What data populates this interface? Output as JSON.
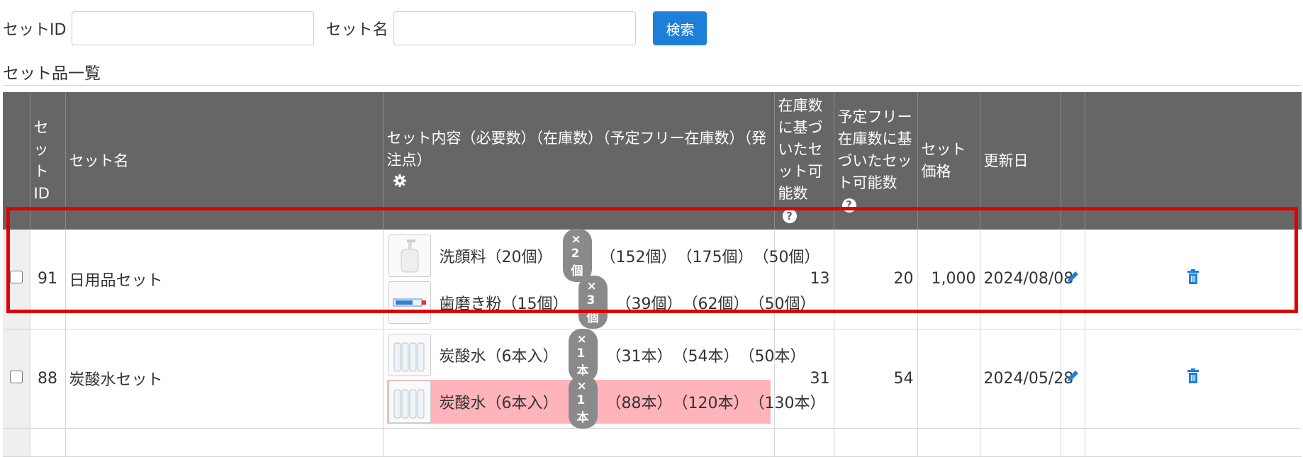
{
  "search": {
    "set_id_label": "セットID",
    "set_id_value": "",
    "set_name_label": "セット名",
    "set_name_value": "",
    "search_button": "検索"
  },
  "section_title": "セット品一覧",
  "table": {
    "headers": {
      "set_id": "セットID",
      "set_name": "セット名",
      "contents": "セット内容（必要数）（在庫数）（予定フリー在庫数）（発注点）",
      "available_by_stock": "在庫数に基づいたセット可能数",
      "available_by_free": "予定フリー在庫数に基づいたセット可能数",
      "price": "セット価格",
      "updated": "更新日"
    },
    "rows": [
      {
        "id": "91",
        "name": "日用品セット",
        "items": [
          {
            "name": "洗顔料（20個）",
            "badge": "× 2個",
            "stock": "（152個）",
            "free": "（175個）",
            "reorder": "（50個）",
            "warn": false,
            "thumb": "soap-bottle"
          },
          {
            "name": "歯磨き粉（15個）",
            "badge": "× 3個",
            "stock": "（39個）",
            "free": "（62個）",
            "reorder": "（50個）",
            "warn": false,
            "thumb": "toothpaste"
          }
        ],
        "by_stock": "13",
        "by_free": "20",
        "price": "1,000",
        "updated": "2024/08/08"
      },
      {
        "id": "88",
        "name": "炭酸水セット",
        "items": [
          {
            "name": "炭酸水（6本入）",
            "badge": "× 1本",
            "stock": "（31本）",
            "free": "（54本）",
            "reorder": "（50本）",
            "warn": false,
            "thumb": "water-bottles"
          },
          {
            "name": "炭酸水（6本入）",
            "badge": "× 1本",
            "stock": "（88本）",
            "free": "（120本）",
            "reorder": "（130本）",
            "warn": true,
            "thumb": "water-bottles"
          }
        ],
        "by_stock": "31",
        "by_free": "54",
        "price": "",
        "updated": "2024/05/28"
      }
    ]
  },
  "colors": {
    "header_bg": "#666666",
    "primary_button": "#1e7fd8",
    "warn_row": "#ffb3bb",
    "highlight_border": "#e00000",
    "badge": "#8a8a8a",
    "action_icon": "#1e7fd8"
  }
}
